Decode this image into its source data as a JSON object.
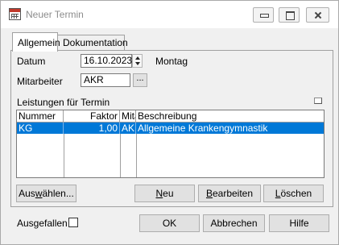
{
  "window": {
    "title": "Neuer Termin"
  },
  "tabs": [
    {
      "label": "Allgemein",
      "active": true
    },
    {
      "label": "Dokumentation",
      "active": false
    }
  ],
  "form": {
    "datum_label": "Datum",
    "datum_value": "16.10.2023",
    "weekday": "Montag",
    "mitarbeiter_label": "Mitarbeiter",
    "mitarbeiter_value": "AKR",
    "browse_label": "..."
  },
  "leistungen": {
    "label": "Leistungen für Termin",
    "columns": [
      "Nummer",
      "Faktor",
      "Mitarb",
      "Beschreibung"
    ],
    "rows": [
      {
        "nummer": "KG",
        "faktor": "1,00",
        "mitarbeiter": "AKR",
        "beschreibung": "Allgemeine Krankengymnastik",
        "selected": true
      }
    ]
  },
  "actions": {
    "auswaehlen": {
      "pre": "Aus",
      "key": "w",
      "post": "ählen..."
    },
    "neu": {
      "pre": "",
      "key": "N",
      "post": "eu"
    },
    "bearbeiten": {
      "pre": "",
      "key": "B",
      "post": "earbeiten"
    },
    "loeschen": {
      "pre": "",
      "key": "L",
      "post": "öschen"
    }
  },
  "footer": {
    "ausgefallen_label": "Ausgefallen",
    "ausgefallen_checked": false,
    "ok_label": "OK",
    "abbrechen_label": "Abbrechen",
    "hilfe_label": "Hilfe"
  },
  "colors": {
    "selection": "#0078d7",
    "window_bg": "#f0f0f0"
  }
}
